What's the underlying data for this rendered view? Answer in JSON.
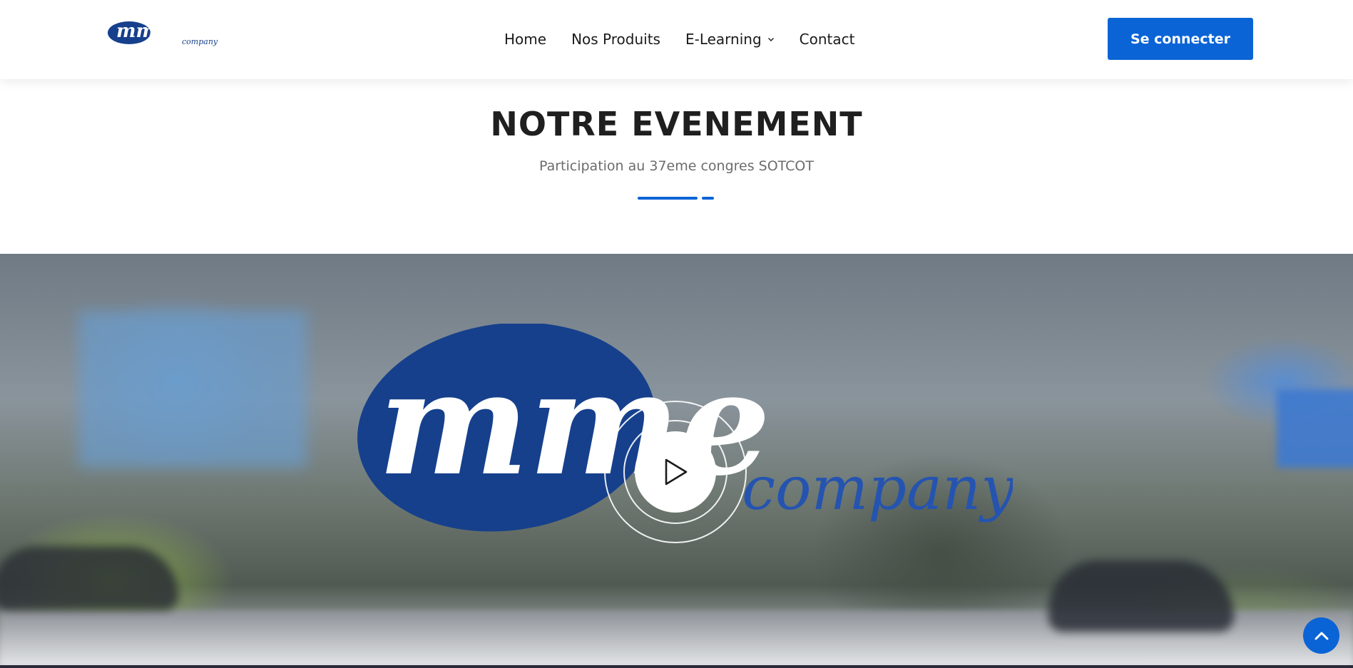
{
  "header": {
    "logo_text": "mme",
    "logo_subtext": "company",
    "nav": [
      {
        "label": "Home"
      },
      {
        "label": "Nos Produits"
      },
      {
        "label": "E-Learning"
      },
      {
        "label": "Contact"
      }
    ],
    "login_label": "Se connecter"
  },
  "event": {
    "title": "NOTRE EVENEMENT",
    "subtitle": "Participation au 37eme congres SOTCOT"
  },
  "video": {
    "logo_text": "mme",
    "logo_subtext": "company",
    "play_icon": "play-icon"
  },
  "scroll_top_icon": "chevron-up-icon",
  "colors": {
    "primary": "#0a64d6",
    "brand_navy": "#16408c",
    "heading": "#1f1f1f",
    "subtitle": "#6c6c6c"
  }
}
